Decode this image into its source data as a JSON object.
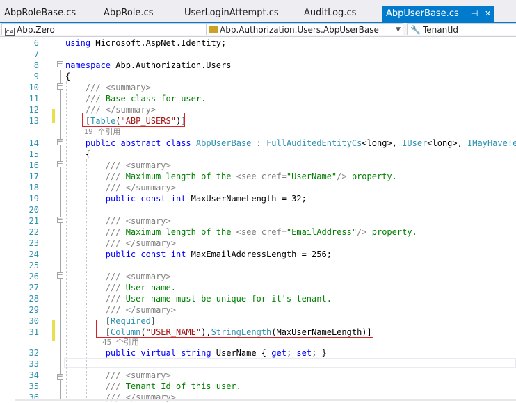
{
  "tabs": [
    {
      "label": "AbpRoleBase.cs"
    },
    {
      "label": "AbpRole.cs"
    },
    {
      "label": "UserLoginAttempt.cs"
    },
    {
      "label": "AuditLog.cs"
    },
    {
      "label": "AbpUserBase.cs",
      "active": true,
      "pin_glyph": "⊣",
      "close_glyph": "✕"
    }
  ],
  "navbar": {
    "project": "Abp.Zero",
    "project_icon": "C#",
    "type": "Abp.Authorization.Users.AbpUserBase",
    "member": "TenantId"
  },
  "lines": [
    {
      "n": "6",
      "text": "using Microsoft.AspNet.Identity;"
    },
    {
      "n": "7",
      "text": ""
    },
    {
      "n": "8",
      "text": "namespace Abp.Authorization.Users"
    },
    {
      "n": "9",
      "text": "{"
    },
    {
      "n": "10",
      "text": "    /// <summary>"
    },
    {
      "n": "11",
      "text": "    /// Base class for user."
    },
    {
      "n": "12",
      "text": "    /// </summary>"
    },
    {
      "n": "13",
      "text": "    [Table(\"ABP_USERS\")]"
    },
    {
      "n": "14",
      "text": "    public abstract class AbpUserBase : FullAuditedEntityCs<long>, IUser<long>, IMayHaveTenant"
    },
    {
      "n": "15",
      "text": "    {"
    },
    {
      "n": "16",
      "text": "        /// <summary>"
    },
    {
      "n": "17",
      "text": "        /// Maximum length of the <see cref=\"UserName\"/> property."
    },
    {
      "n": "18",
      "text": "        /// </summary>"
    },
    {
      "n": "19",
      "text": "        public const int MaxUserNameLength = 32;"
    },
    {
      "n": "20",
      "text": ""
    },
    {
      "n": "21",
      "text": "        /// <summary>"
    },
    {
      "n": "22",
      "text": "        /// Maximum length of the <see cref=\"EmailAddress\"/> property."
    },
    {
      "n": "23",
      "text": "        /// </summary>"
    },
    {
      "n": "24",
      "text": "        public const int MaxEmailAddressLength = 256;"
    },
    {
      "n": "25",
      "text": ""
    },
    {
      "n": "26",
      "text": "        /// <summary>"
    },
    {
      "n": "27",
      "text": "        /// User name."
    },
    {
      "n": "28",
      "text": "        /// User name must be unique for it's tenant."
    },
    {
      "n": "29",
      "text": "        /// </summary>"
    },
    {
      "n": "30",
      "text": "        [Required]"
    },
    {
      "n": "31",
      "text": "        [Column(\"USER_NAME\"),StringLength(MaxUserNameLength)]"
    },
    {
      "n": "32",
      "text": "        public virtual string UserName { get; set; }"
    },
    {
      "n": "33",
      "text": ""
    },
    {
      "n": "34",
      "text": "        /// <summary>"
    },
    {
      "n": "35",
      "text": "        /// Tenant Id of this user."
    },
    {
      "n": "36",
      "text": "        /// </summary>"
    }
  ],
  "codelens": [
    {
      "after_line": "13",
      "text": "    19 个引用"
    },
    {
      "after_line": "31",
      "text": "        45 个引用"
    }
  ]
}
